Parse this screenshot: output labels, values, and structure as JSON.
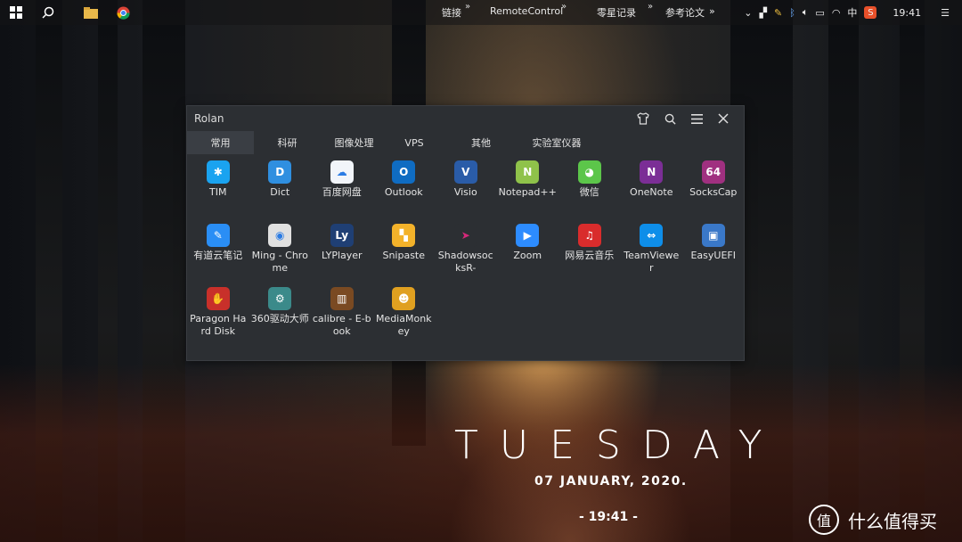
{
  "taskbar": {
    "links_label": "链接",
    "bookmarks": [
      "RemoteControl",
      "零星记录",
      "参考论文"
    ],
    "chevron": "»",
    "tray": {
      "ime": "中",
      "time": "19:41"
    }
  },
  "rolan": {
    "title": "Rolan",
    "tabs": [
      "常用",
      "科研",
      "图像处理",
      "VPS",
      "其他",
      "实验室仪器"
    ],
    "active_tab": "常用",
    "apps": [
      {
        "label": "TIM",
        "icon": "star-icon",
        "color": "#1aa3f0",
        "glyph": "✱"
      },
      {
        "label": "Dict",
        "icon": "dict-icon",
        "color": "#2f8fe0",
        "glyph": "D"
      },
      {
        "label": "百度网盘",
        "icon": "cloud-icon",
        "color": "#f2f5fa",
        "glyph": "☁"
      },
      {
        "label": "Outlook",
        "icon": "outlook-icon",
        "color": "#0f6cc2",
        "glyph": "O"
      },
      {
        "label": "Visio",
        "icon": "visio-icon",
        "color": "#2a5ca8",
        "glyph": "V"
      },
      {
        "label": "Notepad++",
        "icon": "notepad-icon",
        "color": "#8fc24a",
        "glyph": "N"
      },
      {
        "label": "微信",
        "icon": "wechat-icon",
        "color": "#5cc64a",
        "glyph": "◕"
      },
      {
        "label": "OneNote",
        "icon": "onenote-icon",
        "color": "#7b2e96",
        "glyph": "N"
      },
      {
        "label": "SocksCap",
        "icon": "sockscap-icon",
        "color": "#a03080",
        "glyph": "64"
      },
      {
        "label": "有道云笔记",
        "icon": "pen-icon",
        "color": "#2a8ef5",
        "glyph": "✎"
      },
      {
        "label": "Ming - Chrome",
        "icon": "chrome-icon",
        "color": "#e0e0e0",
        "glyph": "◉"
      },
      {
        "label": "LYPlayer",
        "icon": "ly-icon",
        "color": "#1f3f74",
        "glyph": "Ly"
      },
      {
        "label": "Snipaste",
        "icon": "snipaste-icon",
        "color": "#f3b22a",
        "glyph": "▚"
      },
      {
        "label": "ShadowsocksR-",
        "icon": "plane-icon",
        "color": "#2c2f33",
        "glyph": "➤"
      },
      {
        "label": "Zoom",
        "icon": "zoom-icon",
        "color": "#2d8cff",
        "glyph": "▶"
      },
      {
        "label": "网易云音乐",
        "icon": "music-icon",
        "color": "#d92c2c",
        "glyph": "♫"
      },
      {
        "label": "TeamViewer",
        "icon": "teamviewer-icon",
        "color": "#0e8ee9",
        "glyph": "⇔"
      },
      {
        "label": "EasyUEFI",
        "icon": "monitor-icon",
        "color": "#3a78c8",
        "glyph": "▣"
      },
      {
        "label": "Paragon Hard Disk",
        "icon": "paragon-icon",
        "color": "#c8302a",
        "glyph": "✋"
      },
      {
        "label": "360驱动大师",
        "icon": "gear-icon",
        "color": "#3b8a8a",
        "glyph": "⚙"
      },
      {
        "label": "calibre - E-book",
        "icon": "books-icon",
        "color": "#7a4a22",
        "glyph": "▥"
      },
      {
        "label": "MediaMonkey",
        "icon": "monkey-icon",
        "color": "#e0a020",
        "glyph": "☻"
      }
    ]
  },
  "clock": {
    "day": "TUESDAY",
    "date": "07 JANUARY, 2020.",
    "time": "- 19:41 -"
  },
  "watermark": {
    "mark": "值",
    "text": "什么值得买"
  }
}
